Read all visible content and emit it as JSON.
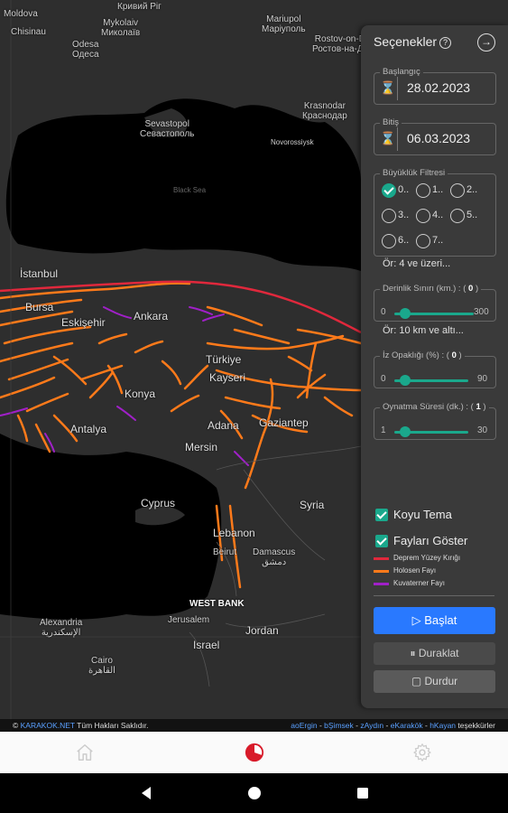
{
  "map": {
    "labels": {
      "moldova": "Moldova",
      "chisinau": "Chisinau",
      "kryvyi": "Кривий Ріг",
      "mykolaiv": "Mykolaiv\nМиколаїв",
      "mariupol": "Mariupol\nМаріуполь",
      "rostov": "Rostov-on-Don\nРостов-на-Дону",
      "odesa": "Odesa\nОдеса",
      "krasnodar": "Krasnodar\nКраснодар",
      "sevastopol": "Sevastopol\nСевастополь",
      "novorossiysk": "Novorossiysk",
      "black_sea": "Black Sea",
      "istanbul": "İstanbul",
      "bursa": "Bursa",
      "eskisehir": "Eskişehir",
      "ankara": "Ankara",
      "turkiye": "Türkiye",
      "kayseri": "Kayseri",
      "konya": "Konya",
      "antalya": "Antalya",
      "adana": "Adana",
      "mersin": "Mersin",
      "gaziantep": "Gaziantep",
      "cyprus": "Cyprus",
      "syria": "Syria",
      "lebanon": "Lebanon",
      "beirut": "Beirut",
      "damascus": "Damascus\nدمشق",
      "west_bank": "WEST BANK",
      "jerusalem": "Jerusalem",
      "israel": "Israel",
      "jordan": "Jordan",
      "alexandria": "Alexandria\nالإسكندرية",
      "cairo": "Cairo\nالقاهرة"
    }
  },
  "panel": {
    "title": "Seçenekler",
    "help_glyph": "?",
    "collapse_glyph": "→",
    "start_label": "Başlangıç",
    "start_value": "28.02.2023",
    "end_label": "Bitiş",
    "end_value": "06.03.2023",
    "magnitude_label": "Büyüklük Filtresi",
    "magnitude_options": [
      "0..",
      "1..",
      "2..",
      "3..",
      "4..",
      "5..",
      "6..",
      "7.."
    ],
    "magnitude_selected": "0..",
    "magnitude_note": "Ör: 4 ve üzeri...",
    "depth_label": "Derinlik Sınırı (km.) :",
    "depth_value": "0",
    "depth_min": "0",
    "depth_max": "300",
    "depth_note": "Ör: 10 km ve altı...",
    "opacity_label": "İz Opaklığı (%) :",
    "opacity_value": "0",
    "opacity_min": "0",
    "opacity_max": "90",
    "duration_label": "Oynatma Süresi (dk.) :",
    "duration_value": "1",
    "duration_min": "1",
    "duration_max": "30",
    "dark_theme": "Koyu Tema",
    "show_faults": "Fayları Göster",
    "legend": [
      {
        "label": "Deprem Yüzey Kırığı",
        "color": "#e0283c"
      },
      {
        "label": "Holosen Fayı",
        "color": "#ff7a1a"
      },
      {
        "label": "Kuvaterner Fayı",
        "color": "#a020c8"
      }
    ],
    "start_button": "▷ Başlat",
    "pause_button": "⏸ Duraklat",
    "stop_button": "▢ Durdur"
  },
  "credit": {
    "left_link": "KARAKOK.NET",
    "left_text": "Tüm Hakları Saklıdır.",
    "prefix": "©",
    "names": [
      "aoErgin",
      "bŞimsek",
      "zAydın",
      "eKarakök",
      "hKayan"
    ],
    "suffix": "teşekkürler"
  },
  "colors": {
    "accent": "#1aa88c",
    "primary_button": "#2979ff",
    "holocene": "#ff7a1a",
    "rupture": "#e0283c",
    "quaternary": "#a020c8"
  },
  "nav": {
    "home": "home-icon",
    "center": "karakok-logo-icon",
    "settings": "gear-icon"
  }
}
